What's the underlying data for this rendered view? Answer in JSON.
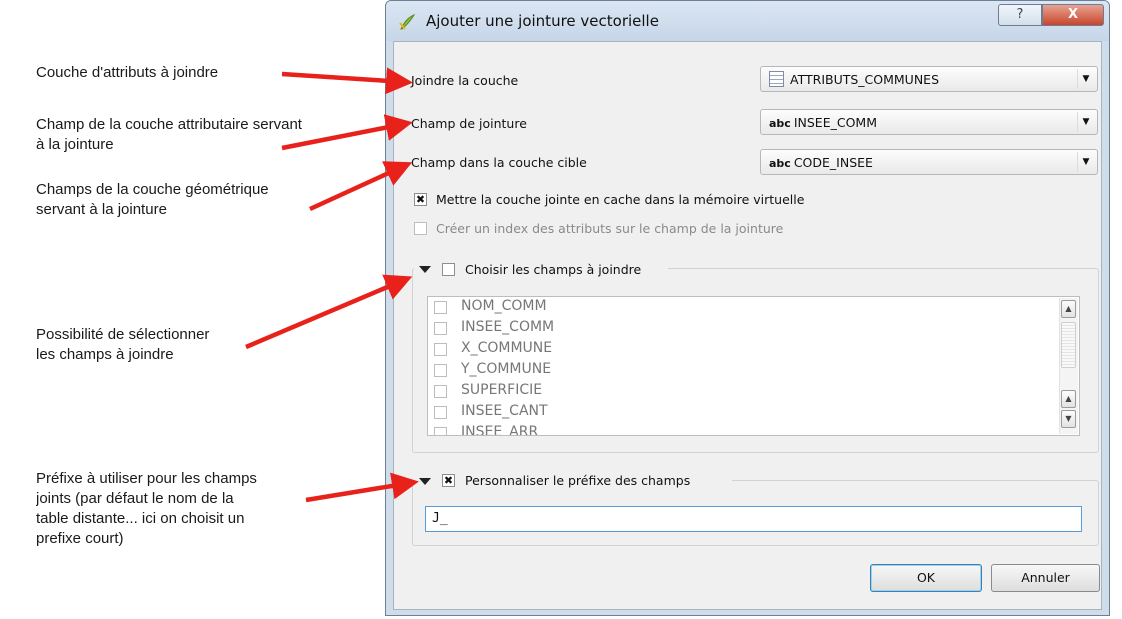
{
  "annotations": [
    {
      "lines": [
        "Couche d'attributs à joindre"
      ]
    },
    {
      "lines": [
        "Champ de la couche attributaire servant",
        "à la jointure"
      ]
    },
    {
      "lines": [
        "Champs de la couche géométrique",
        "servant à la jointure"
      ]
    },
    {
      "lines": [
        "Possibilité de sélectionner",
        "les champs à joindre"
      ]
    },
    {
      "lines": [
        "Préfixe à utiliser pour les champs",
        "joints (par défaut le nom de la",
        "table distante... ici on choisit un",
        "prefixe court)"
      ]
    }
  ],
  "window": {
    "title": "Ajouter une jointure vectorielle",
    "help_glyph": "?",
    "close_glyph": "X"
  },
  "form": {
    "join_layer_label": "Joindre la couche",
    "join_layer_value": "ATTRIBUTS_COMMUNES",
    "join_field_label": "Champ de jointure",
    "join_field_value": "INSEE_COMM",
    "target_field_label": "Champ dans la couche cible",
    "target_field_value": "CODE_INSEE",
    "field_type_tag": "abc",
    "dropdown_glyph": "▼"
  },
  "options": {
    "cache_label": "Mettre la couche jointe en cache dans la mémoire virtuelle",
    "cache_checked": true,
    "index_label": "Créer un index des attributs sur le champ de la jointure",
    "index_checked": false,
    "index_enabled": false,
    "check_glyph": "✖"
  },
  "choose_fields": {
    "label": "Choisir les champs à joindre",
    "checked": false,
    "fields": [
      "NOM_COMM",
      "INSEE_COMM",
      "X_COMMUNE",
      "Y_COMMUNE",
      "SUPERFICIE",
      "INSEE_CANT",
      "INSEE_ARR"
    ],
    "scroll_up_glyph": "▲",
    "scroll_down_glyph": "▼"
  },
  "prefix": {
    "label": "Personnaliser le préfixe des champs",
    "checked": true,
    "value": "J_"
  },
  "buttons": {
    "ok": "OK",
    "cancel": "Annuler"
  }
}
